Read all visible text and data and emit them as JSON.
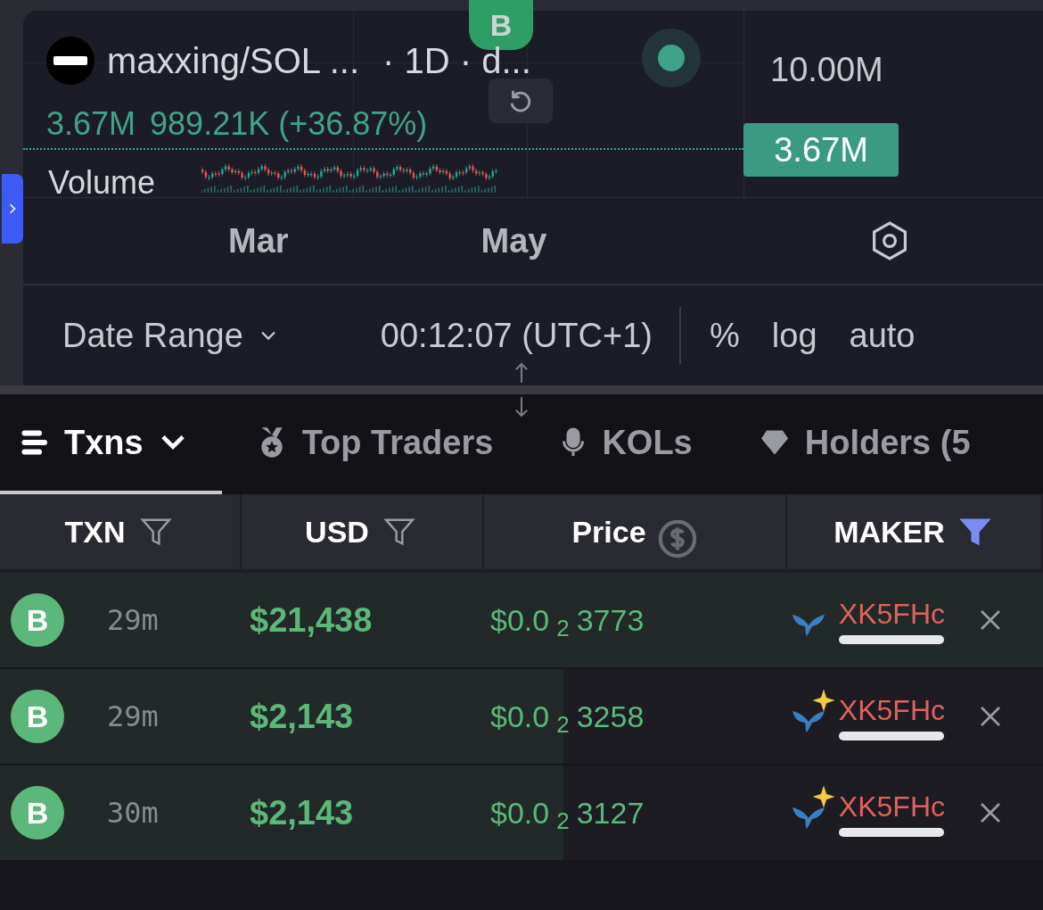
{
  "chart": {
    "badge": "B",
    "title": "maxxing/SOL ...",
    "interval": "· 1D · d...",
    "axis_label": "10.00M",
    "volume_value": "3.67M",
    "volume_stats": "989.21K (+36.87%)",
    "volume_label": "Volume",
    "price_tag": "3.67M",
    "time_labels": [
      "Mar",
      "May"
    ]
  },
  "toolbar": {
    "date_range": "Date Range",
    "time": "00:12:07 (UTC+1)",
    "options": [
      "%",
      "log",
      "auto"
    ]
  },
  "tabs": [
    {
      "label": "Txns",
      "selected": true,
      "kind": "list"
    },
    {
      "label": "Top Traders",
      "selected": false,
      "kind": "medal"
    },
    {
      "label": "KOLs",
      "selected": false,
      "kind": "mic"
    },
    {
      "label": "Holders (5",
      "selected": false,
      "kind": "diamond"
    }
  ],
  "columns": [
    {
      "label": "TXN",
      "kind": "filter",
      "active": false
    },
    {
      "label": "USD",
      "kind": "filter",
      "active": false
    },
    {
      "label": "Price",
      "kind": "currency"
    },
    {
      "label": "MAKER",
      "kind": "filter",
      "active": true
    }
  ],
  "rows": [
    {
      "type": "B",
      "age": "29m",
      "usd": "$21,438",
      "price_prefix": "$0.0",
      "price_zeros": "2",
      "price_digits": "3773",
      "maker": "XK5FHc",
      "level": 1,
      "sparkle": false
    },
    {
      "type": "B",
      "age": "29m",
      "usd": "$2,143",
      "price_prefix": "$0.0",
      "price_zeros": "2",
      "price_digits": "3258",
      "maker": "XK5FHc",
      "level": 0.54,
      "sparkle": true
    },
    {
      "type": "B",
      "age": "30m",
      "usd": "$2,143",
      "price_prefix": "$0.0",
      "price_zeros": "2",
      "price_digits": "3127",
      "maker": "XK5FHc",
      "level": 0.54,
      "sparkle": true
    }
  ]
}
